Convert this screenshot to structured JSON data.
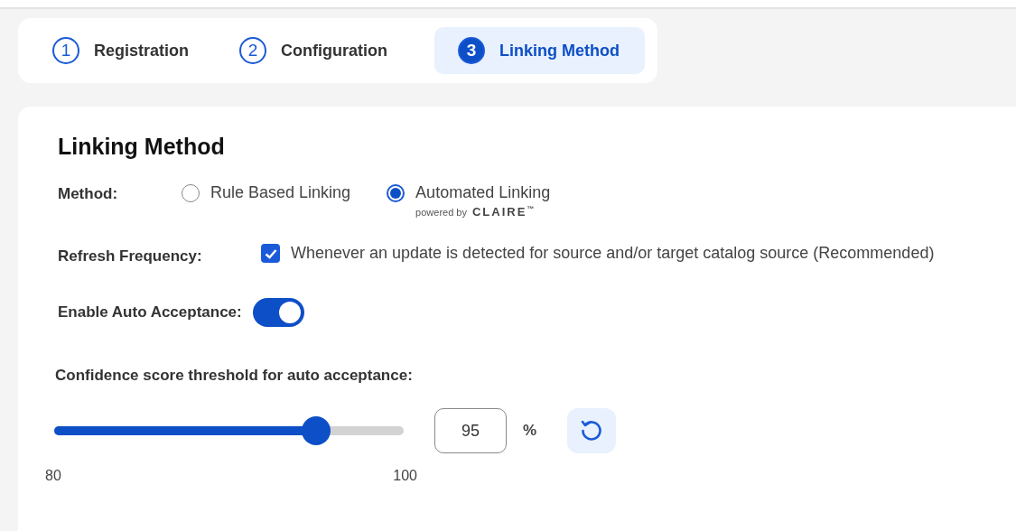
{
  "steps": [
    {
      "number": "1",
      "label": "Registration",
      "selected": false
    },
    {
      "number": "2",
      "label": "Configuration",
      "selected": false
    },
    {
      "number": "3",
      "label": "Linking Method",
      "selected": true
    }
  ],
  "panel": {
    "title": "Linking Method",
    "method": {
      "label": "Method:",
      "options": [
        {
          "label": "Rule Based Linking",
          "selected": false
        },
        {
          "label": "Automated Linking",
          "selected": true,
          "powered_by": "powered by",
          "brand": "CLAIRE",
          "trademark": "™"
        }
      ]
    },
    "refresh": {
      "label": "Refresh Frequency:",
      "option": "Whenever an update is detected for source and/or target catalog source (Recommended)",
      "checked": true
    },
    "auto_accept": {
      "label": "Enable Auto Acceptance:",
      "on": true
    },
    "threshold": {
      "label": "Confidence score threshold for auto acceptance:",
      "level": 0.75,
      "min": "80",
      "max": "100",
      "value": "95",
      "unit": "%"
    }
  }
}
